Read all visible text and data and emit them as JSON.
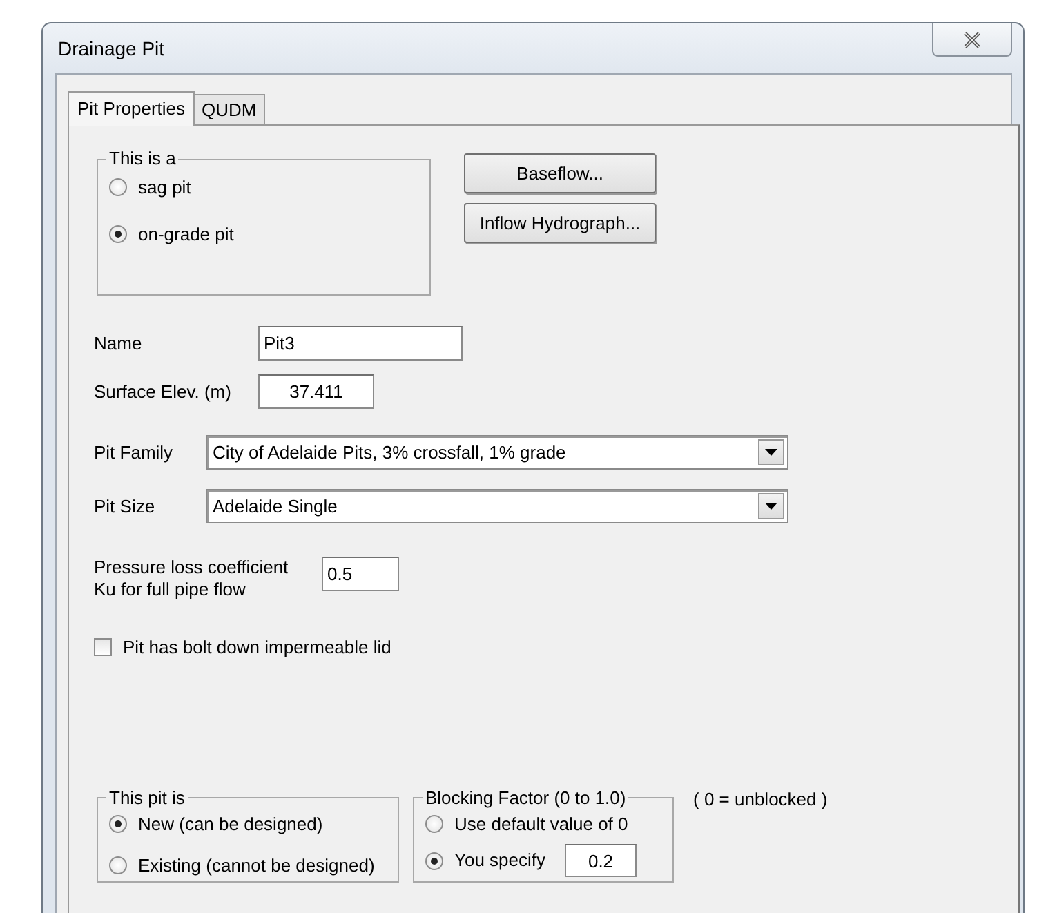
{
  "window": {
    "title": "Drainage Pit"
  },
  "tabs": [
    {
      "label": "Pit Properties",
      "selected": true
    },
    {
      "label": "QUDM",
      "selected": false
    }
  ],
  "pit_type": {
    "legend": "This is a",
    "options": [
      {
        "label": "sag pit",
        "selected": false
      },
      {
        "label": "on-grade pit",
        "selected": true
      }
    ]
  },
  "buttons": [
    "Baseflow...",
    "Inflow Hydrograph..."
  ],
  "name": {
    "label": "Name",
    "value": "Pit3"
  },
  "surface_elev": {
    "label": "Surface Elev. (m)",
    "value": "37.411"
  },
  "pit_family": {
    "label": "Pit Family",
    "value": "City of Adelaide Pits, 3% crossfall, 1% grade"
  },
  "pit_size": {
    "label": "Pit Size",
    "value": "Adelaide Single"
  },
  "pressure_loss": {
    "label_lines": [
      "Pressure loss coefficient",
      "Ku for full pipe flow"
    ],
    "value": "0.5"
  },
  "bolt_down_lid": {
    "label": "Pit has bolt down impermeable lid",
    "checked": false
  },
  "pit_status": {
    "legend": "This pit is",
    "options": [
      {
        "label": "New (can be designed)",
        "selected": true
      },
      {
        "label": "Existing (cannot be designed)",
        "selected": false
      }
    ]
  },
  "blocking_factor": {
    "legend": "Blocking Factor (0 to 1.0)",
    "options": [
      {
        "label": "Use default value of 0",
        "selected": false
      },
      {
        "label": "You specify",
        "selected": true
      }
    ],
    "value": "0.2",
    "note": "( 0 = unblocked )"
  }
}
